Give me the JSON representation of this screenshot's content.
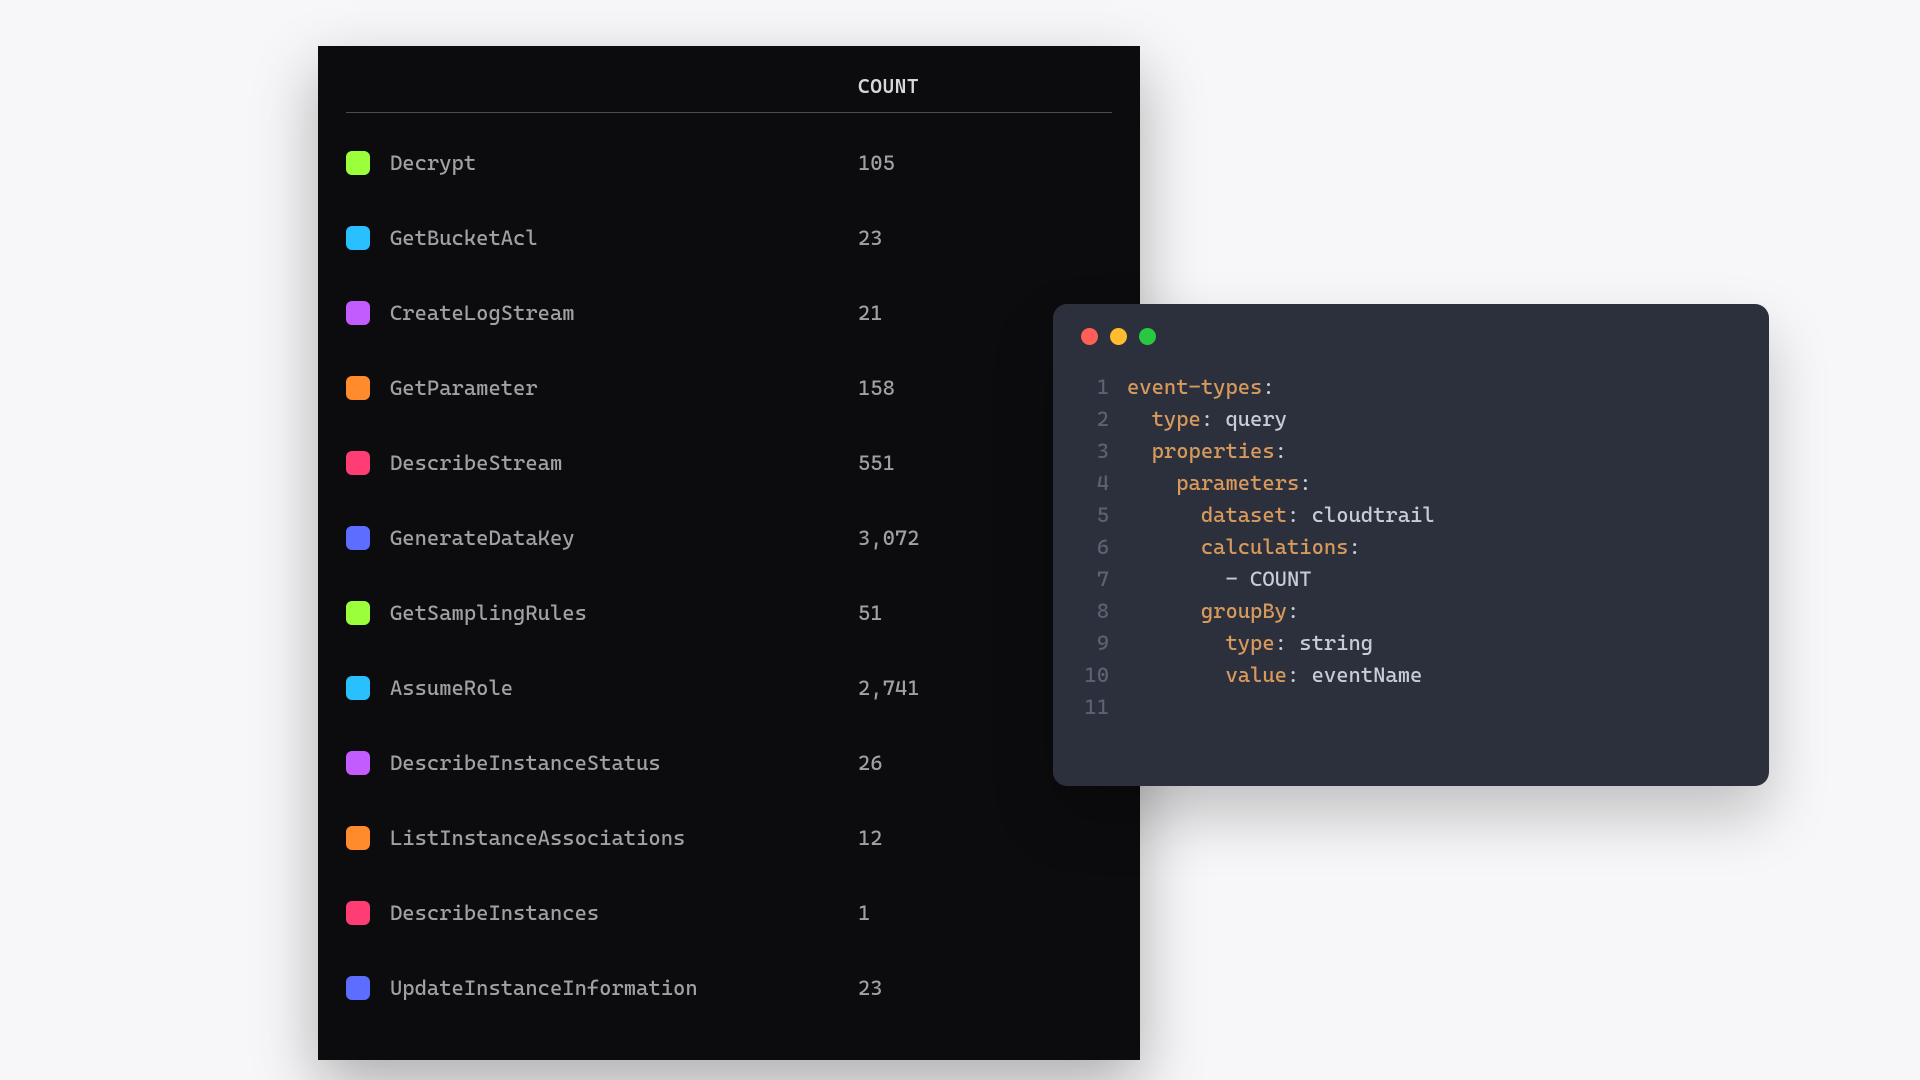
{
  "panel": {
    "count_header": "COUNT",
    "rows": [
      {
        "name": "Decrypt",
        "count": "105",
        "color": "#9cff3b"
      },
      {
        "name": "GetBucketAcl",
        "count": "23",
        "color": "#29c0ff"
      },
      {
        "name": "CreateLogStream",
        "count": "21",
        "color": "#c25cff"
      },
      {
        "name": "GetParameter",
        "count": "158",
        "color": "#ff8b2d"
      },
      {
        "name": "DescribeStream",
        "count": "551",
        "color": "#ff3d75"
      },
      {
        "name": "GenerateDataKey",
        "count": "3,072",
        "color": "#5c6dff"
      },
      {
        "name": "GetSamplingRules",
        "count": "51",
        "color": "#9cff3b"
      },
      {
        "name": "AssumeRole",
        "count": "2,741",
        "color": "#29c0ff"
      },
      {
        "name": "DescribeInstanceStatus",
        "count": "26",
        "color": "#c25cff"
      },
      {
        "name": "ListInstanceAssociations",
        "count": "12",
        "color": "#ff8b2d"
      },
      {
        "name": "DescribeInstances",
        "count": "1",
        "color": "#ff3d75"
      },
      {
        "name": "UpdateInstanceInformation",
        "count": "23",
        "color": "#5c6dff"
      }
    ]
  },
  "editor": {
    "lines": [
      [
        {
          "t": "key",
          "v": "event-types"
        },
        {
          "t": "punc",
          "v": ":"
        }
      ],
      [
        {
          "t": "plain",
          "v": "  "
        },
        {
          "t": "key",
          "v": "type"
        },
        {
          "t": "punc",
          "v": ": "
        },
        {
          "t": "val",
          "v": "query"
        }
      ],
      [
        {
          "t": "plain",
          "v": "  "
        },
        {
          "t": "key",
          "v": "properties"
        },
        {
          "t": "punc",
          "v": ":"
        }
      ],
      [
        {
          "t": "plain",
          "v": "    "
        },
        {
          "t": "key",
          "v": "parameters"
        },
        {
          "t": "punc",
          "v": ":"
        }
      ],
      [
        {
          "t": "plain",
          "v": "      "
        },
        {
          "t": "key",
          "v": "dataset"
        },
        {
          "t": "punc",
          "v": ": "
        },
        {
          "t": "val",
          "v": "cloudtrail"
        }
      ],
      [
        {
          "t": "plain",
          "v": "      "
        },
        {
          "t": "key",
          "v": "calculations"
        },
        {
          "t": "punc",
          "v": ":"
        }
      ],
      [
        {
          "t": "plain",
          "v": "        "
        },
        {
          "t": "dash",
          "v": "- "
        },
        {
          "t": "val",
          "v": "COUNT"
        }
      ],
      [
        {
          "t": "plain",
          "v": "      "
        },
        {
          "t": "key",
          "v": "groupBy"
        },
        {
          "t": "punc",
          "v": ":"
        }
      ],
      [
        {
          "t": "plain",
          "v": "        "
        },
        {
          "t": "key",
          "v": "type"
        },
        {
          "t": "punc",
          "v": ": "
        },
        {
          "t": "val",
          "v": "string"
        }
      ],
      [
        {
          "t": "plain",
          "v": "        "
        },
        {
          "t": "key",
          "v": "value"
        },
        {
          "t": "punc",
          "v": ": "
        },
        {
          "t": "val",
          "v": "eventName"
        }
      ],
      []
    ]
  },
  "chart_data": {
    "type": "table",
    "columns": [
      "eventName",
      "COUNT"
    ],
    "rows": [
      [
        "Decrypt",
        105
      ],
      [
        "GetBucketAcl",
        23
      ],
      [
        "CreateLogStream",
        21
      ],
      [
        "GetParameter",
        158
      ],
      [
        "DescribeStream",
        551
      ],
      [
        "GenerateDataKey",
        3072
      ],
      [
        "GetSamplingRules",
        51
      ],
      [
        "AssumeRole",
        2741
      ],
      [
        "DescribeInstanceStatus",
        26
      ],
      [
        "ListInstanceAssociations",
        12
      ],
      [
        "DescribeInstances",
        1
      ],
      [
        "UpdateInstanceInformation",
        23
      ]
    ]
  }
}
